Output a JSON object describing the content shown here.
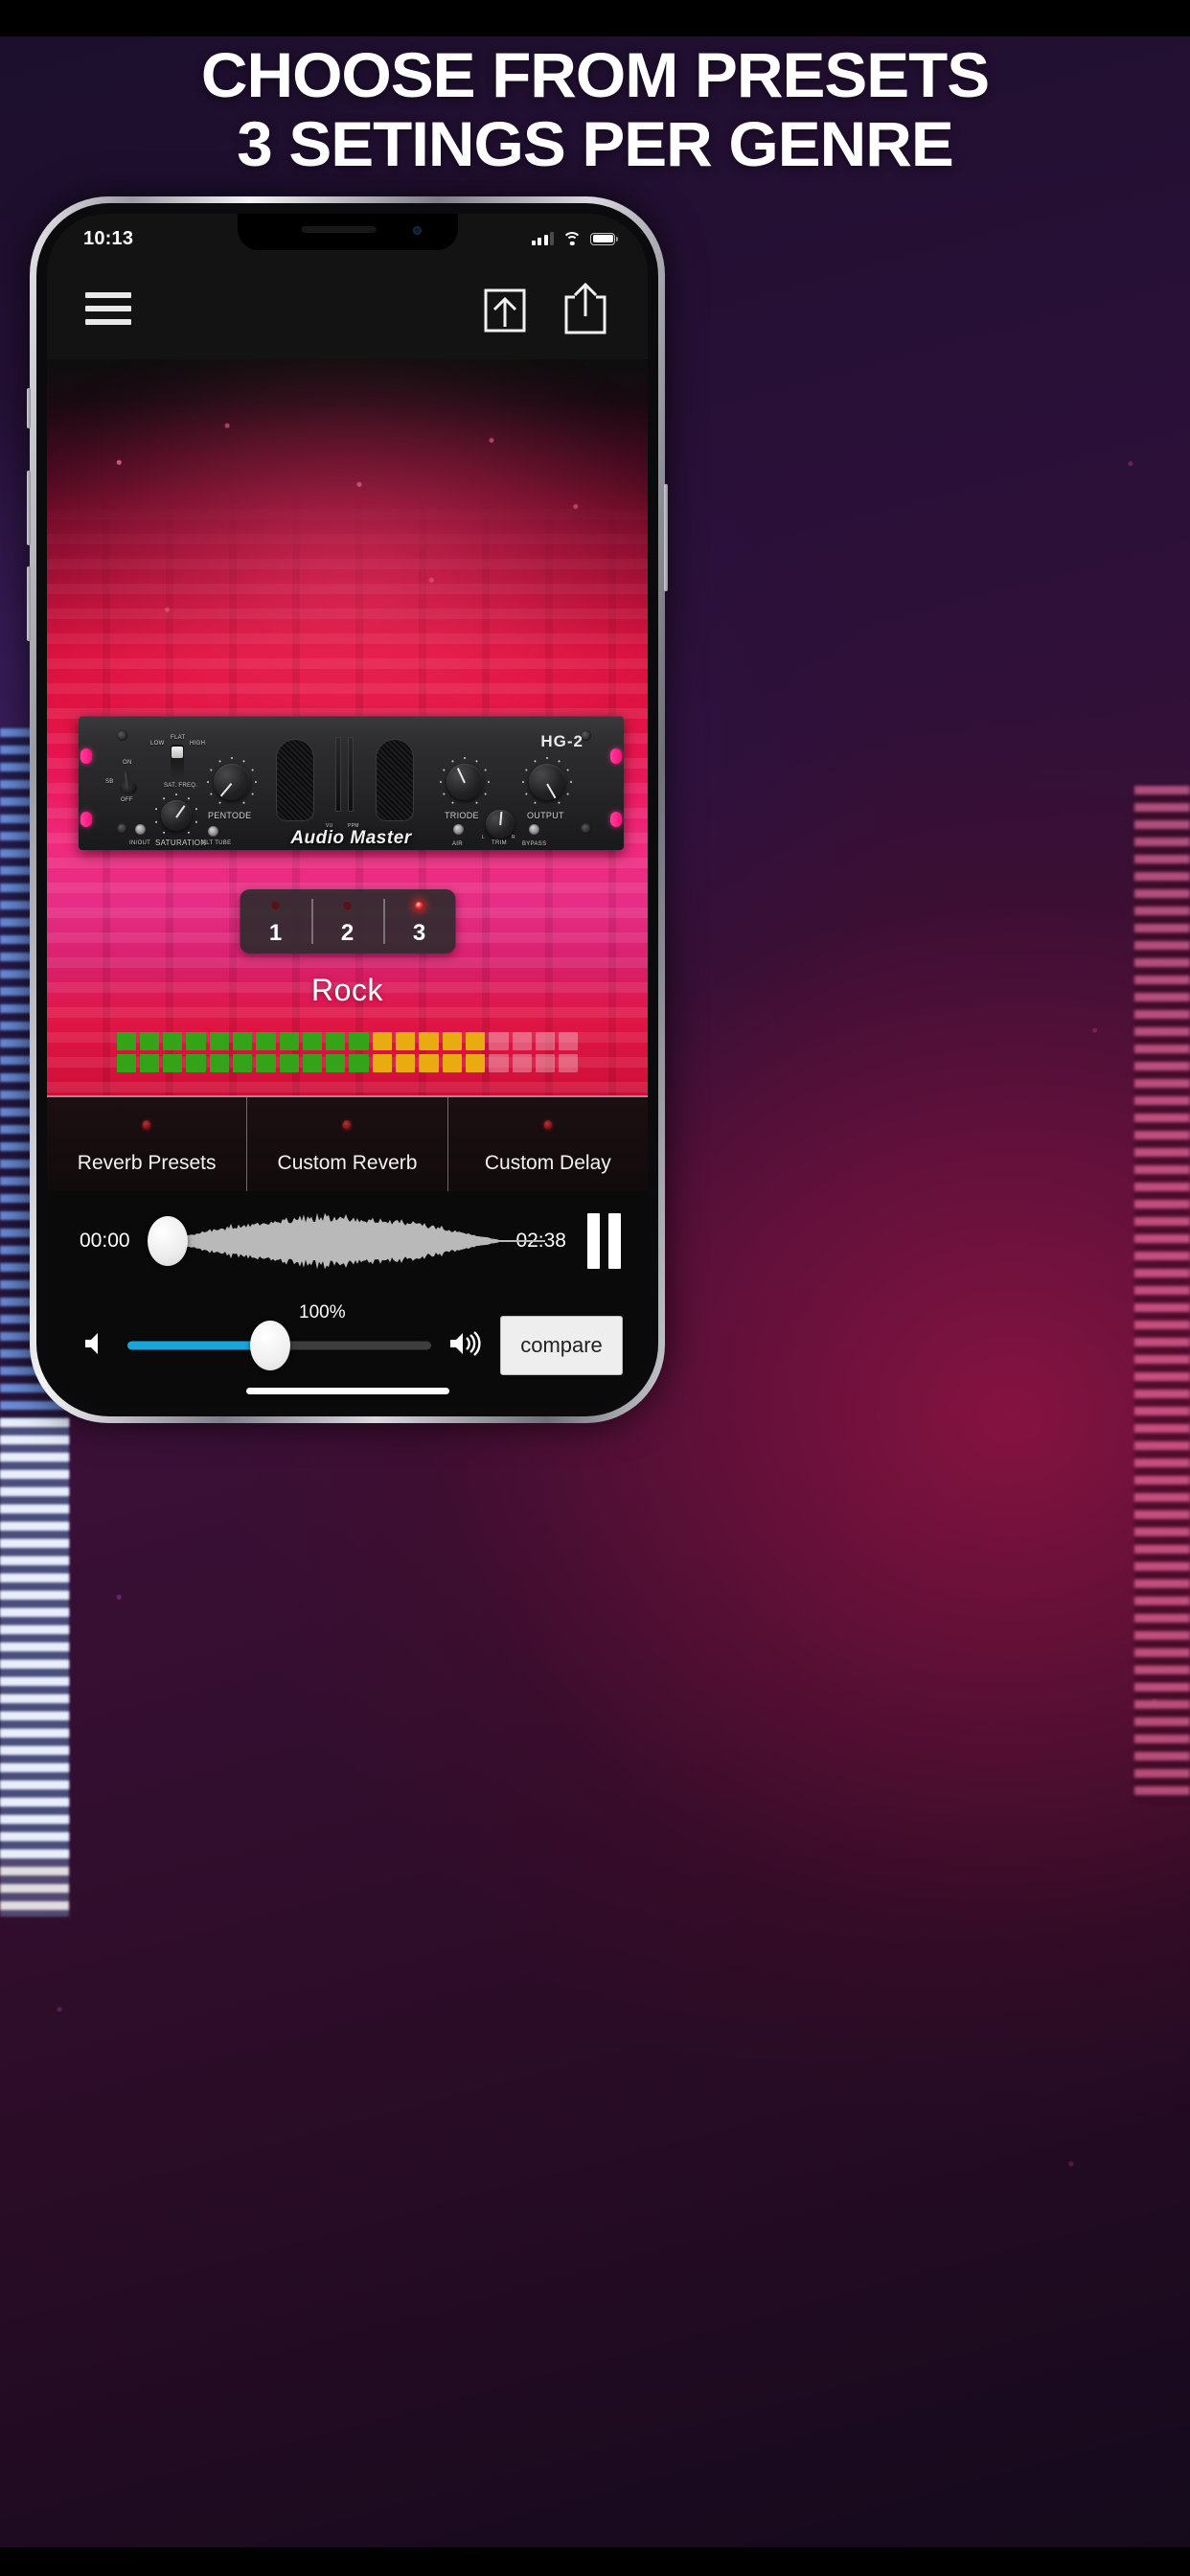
{
  "promo": {
    "headline_line1": "CHOOSE FROM PRESETS",
    "headline_line2": "3 SETINGS PER GENRE"
  },
  "status_bar": {
    "time": "10:13",
    "signal_icon": "cellular-signal-icon",
    "wifi_icon": "wifi-icon",
    "battery_icon": "battery-icon"
  },
  "topbar": {
    "menu_icon": "hamburger-menu-icon",
    "import_icon": "import-arrow-into-box-icon",
    "share_icon": "share-arrow-out-of-box-icon"
  },
  "rack": {
    "model": "HG-2",
    "brand": "Audio Master",
    "labels": {
      "low": "LOW",
      "flat": "FLAT",
      "high": "HIGH",
      "on": "ON",
      "off": "OFF",
      "sb": "SB",
      "sat_freq": "SAT. FREQ.",
      "pentode": "PENTODE",
      "saturation": "SATURATION",
      "in_out": "IN/OUT",
      "alt_tube": "ALT TUBE",
      "vu": "VU",
      "ppm": "PPM",
      "triode": "TRIODE",
      "output": "OUTPUT",
      "air": "AIR",
      "trim": "TRIM",
      "bypass": "BYPASS",
      "trim_l": "L",
      "trim_r": "R"
    }
  },
  "presets": {
    "active_index": 2,
    "items": [
      {
        "number": "1",
        "active": false
      },
      {
        "number": "2",
        "active": false
      },
      {
        "number": "3",
        "active": true
      }
    ],
    "genre": "Rock"
  },
  "meter": {
    "green_count": 11,
    "amber_count": 5,
    "dim_count": 4,
    "colors": {
      "green": "#35a318",
      "amber": "#e8ab12",
      "dim": "#ffffff4d"
    }
  },
  "tabs": [
    {
      "label": "Reverb Presets",
      "led": "red-led-icon"
    },
    {
      "label": "Custom Reverb",
      "led": "red-led-icon"
    },
    {
      "label": "Custom Delay",
      "led": "red-led-icon"
    }
  ],
  "transport": {
    "current_time": "00:00",
    "total_time": "02:38",
    "playback_icon": "pause-icon",
    "scrub_position_pct": 1
  },
  "volume": {
    "percent_label": "100%",
    "value_pct": 47,
    "mute_icon": "speaker-muted-icon",
    "loud_icon": "speaker-loud-icon",
    "accent_color": "#18a6da",
    "compare_label": "compare"
  }
}
